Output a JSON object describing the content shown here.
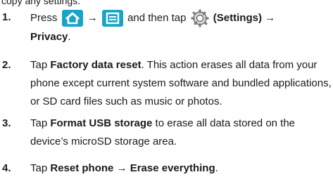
{
  "intro_partial": "copy any settings.",
  "steps": [
    {
      "number": "1.",
      "press": "Press",
      "then_tap": "and then tap",
      "settings_label": "(Settings)",
      "arrow": "→",
      "privacy": "Privacy",
      "period": "."
    },
    {
      "number": "2.",
      "pre": "Tap",
      "bold": "Factory data reset",
      "rest": ". This action erases all data from your phone except current system software and bundled applications, or SD card files such as music or photos."
    },
    {
      "number": "3.",
      "pre": "Tap",
      "bold": "Format USB storage",
      "rest": " to erase all data stored on the device’s microSD storage area."
    },
    {
      "number": "4.",
      "pre": "Tap",
      "bold": "Reset phone → Erase everything",
      "rest": "."
    }
  ],
  "icons": [
    "home-icon",
    "menu-icon",
    "settings-gear-icon"
  ],
  "colors": {
    "icon_blue": "#1aa3c8",
    "text": "#1a1a1a"
  }
}
